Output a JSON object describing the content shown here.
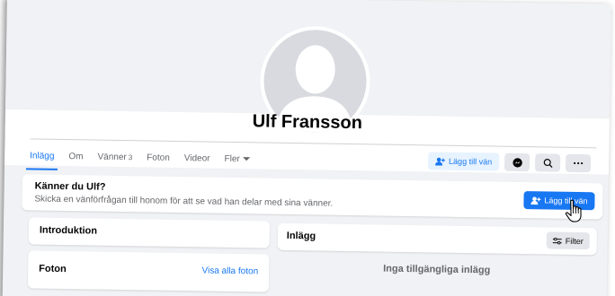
{
  "profile": {
    "name": "Ulf Fransson"
  },
  "tabs": [
    {
      "label": "Inlägg",
      "active": true
    },
    {
      "label": "Om"
    },
    {
      "label": "Vänner",
      "count": "3"
    },
    {
      "label": "Foton"
    },
    {
      "label": "Videor"
    },
    {
      "label": "Fler"
    }
  ],
  "actions": {
    "add_friend_label": "Lägg till vän"
  },
  "know_card": {
    "title": "Känner du Ulf?",
    "subtitle": "Skicka en vänförfrågan till honom för att se vad han delar med sina vänner.",
    "button_label": "Lägg till vän"
  },
  "intro": {
    "title": "Introduktion"
  },
  "posts": {
    "title": "Inlägg",
    "filter_label": "Filter",
    "empty_text": "Inga tillgängliga inlägg"
  },
  "photos": {
    "title": "Foton",
    "link_label": "Visa alla foton"
  },
  "colors": {
    "accent": "#1877f2",
    "background": "#f0f2f5"
  },
  "icons": [
    "add-friend-icon",
    "messenger-icon",
    "search-icon",
    "more-icon",
    "filter-icon",
    "hand-pointer-icon"
  ]
}
